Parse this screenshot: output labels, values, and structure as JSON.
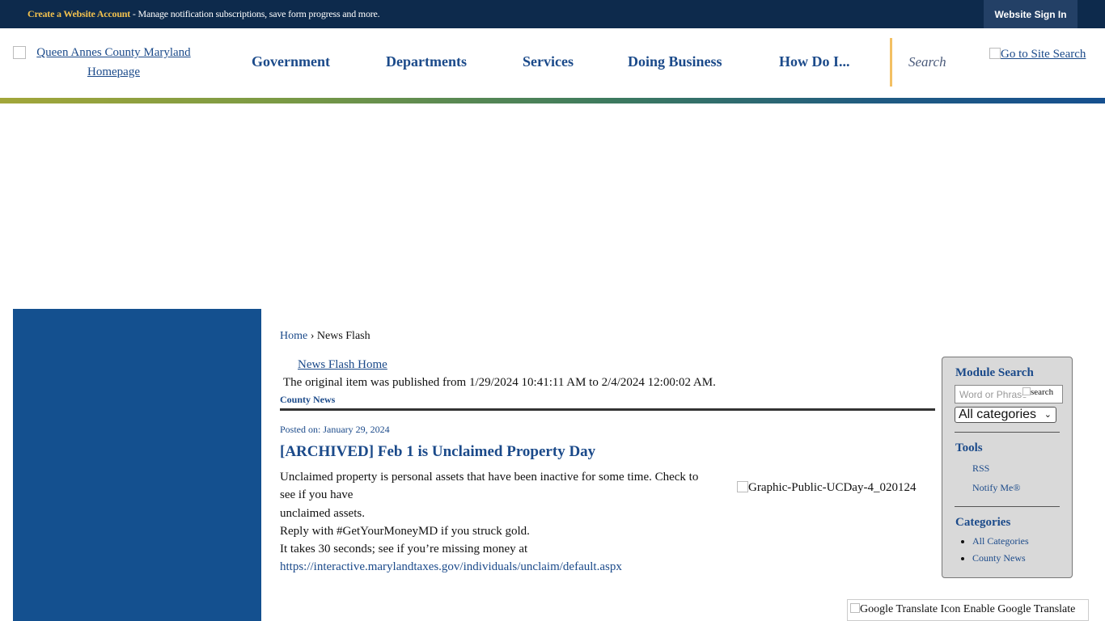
{
  "topbar": {
    "create_label": "Create a Website Account",
    "message": " - Manage notification subscriptions, save form progress and more.",
    "signin_label": "Website Sign In"
  },
  "header": {
    "logo_alt": "Queen Annes County Maryland Homepage",
    "nav": [
      "Government",
      "Departments",
      "Services",
      "Doing Business",
      "How Do I..."
    ],
    "search_placeholder": "Search",
    "go_search_alt": "Go to Site Search"
  },
  "breadcrumb": {
    "home": "Home",
    "separator": "›",
    "current": "News Flash"
  },
  "main": {
    "news_flash_home": "News Flash Home",
    "original_notice": "The original item was published from 1/29/2024 10:41:11 AM to 2/4/2024 12:00:02 AM.",
    "category": "County News",
    "posted": "Posted on: January 29, 2024",
    "title": "[ARCHIVED] Feb 1 is Unclaimed Property Day",
    "body_lines": [
      "Unclaimed property is personal assets that have been inactive for some time. Check to see if you have",
      "unclaimed assets.",
      "Reply with #GetYourMoneyMD if you struck gold.",
      "It takes 30 seconds; see if you’re missing money at"
    ],
    "link": "https://interactive.marylandtaxes.gov/individuals/unclaim/default.aspx",
    "graphic_alt": "Graphic-Public-UCDay-4_020124"
  },
  "module": {
    "search_title": "Module Search",
    "search_placeholder": "Word or Phrase",
    "search_button_alt": "search",
    "category_select": "All categories",
    "tools_title": "Tools",
    "tools": [
      "RSS",
      "Notify Me®"
    ],
    "categories_title": "Categories",
    "categories": [
      "All Categories",
      "County News"
    ]
  },
  "translate": {
    "label": "Google Translate Icon Enable Google Translate"
  },
  "colors": {
    "topbar": "#0d2a4c",
    "link_blue": "#1b4a8a",
    "left_column": "#14508f",
    "accent_gold": "#f2c14e"
  }
}
